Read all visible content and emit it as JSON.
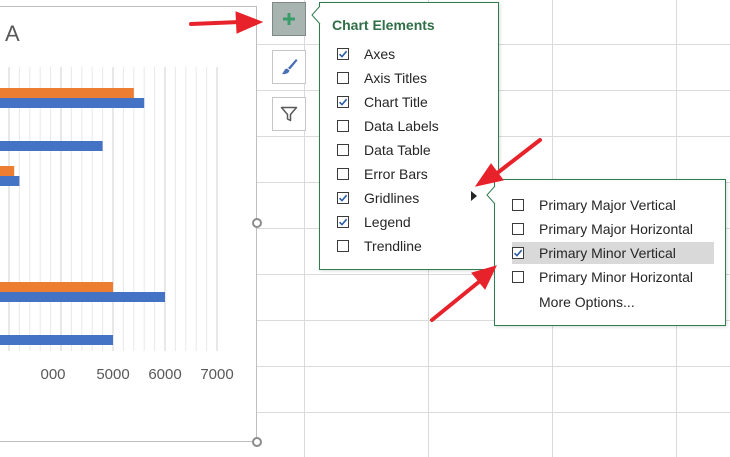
{
  "chart": {
    "title": "A",
    "chart_data": {
      "type": "bar",
      "orientation": "horizontal",
      "x_tick_labels": [
        "000",
        "5000",
        "6000",
        "7000"
      ],
      "xlim": [
        3000,
        7000
      ],
      "grid": "minor-vertical",
      "series": [
        {
          "color": "#ed7d31",
          "values": [
            5400,
            null,
            3100,
            null,
            5000,
            null
          ]
        },
        {
          "color": "#4472c4",
          "values": [
            5600,
            4800,
            3200,
            null,
            6000,
            5000
          ]
        }
      ]
    }
  },
  "side_buttons": [
    {
      "name": "chart-elements-button",
      "icon": "plus-icon",
      "active": true
    },
    {
      "name": "chart-styles-button",
      "icon": "paintbrush-icon",
      "active": false
    },
    {
      "name": "chart-filters-button",
      "icon": "funnel-icon",
      "active": false
    }
  ],
  "chart_elements": {
    "title": "Chart Elements",
    "items": [
      {
        "label": "Axes",
        "checked": true
      },
      {
        "label": "Axis Titles",
        "checked": false
      },
      {
        "label": "Chart Title",
        "checked": true
      },
      {
        "label": "Data Labels",
        "checked": false
      },
      {
        "label": "Data Table",
        "checked": false
      },
      {
        "label": "Error Bars",
        "checked": false
      },
      {
        "label": "Gridlines",
        "checked": true
      },
      {
        "label": "Legend",
        "checked": true
      },
      {
        "label": "Trendline",
        "checked": false
      }
    ]
  },
  "gridlines_submenu": {
    "items": [
      {
        "label": "Primary Major Vertical",
        "checked": false
      },
      {
        "label": "Primary Major Horizontal",
        "checked": false
      },
      {
        "label": "Primary Minor Vertical",
        "checked": true,
        "highlighted": true
      },
      {
        "label": "Primary Minor Horizontal",
        "checked": false
      }
    ],
    "more_options": "More Options..."
  },
  "colors": {
    "accent_green": "#2f6e46",
    "annotation_red": "#e8222a"
  }
}
